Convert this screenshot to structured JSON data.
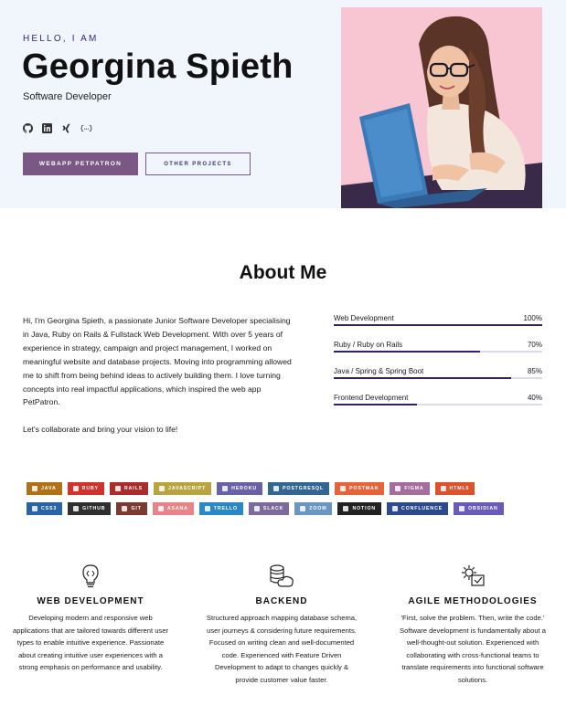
{
  "hero": {
    "greeting": "HELLO, I AM",
    "name": "Georgina Spieth",
    "role": "Software Developer",
    "socials": [
      "github-icon",
      "linkedin-icon",
      "xing-icon",
      "code-icon"
    ],
    "primary_button": "WEBAPP PETPATRON",
    "secondary_button": "OTHER PROJECTS"
  },
  "about": {
    "title": "About Me",
    "bio": [
      "Hi, I'm Georgina Spieth, a passionate Junior Software Developer specialising in Java, Ruby on Rails & Fullstack Web Development. With over 5 years of experience in strategy, campaign and project management, I worked on meaningful website and database projects. Moving into programming allowed me to shift from being behind ideas to actively building them. I love turning concepts into real impactful applications, which inspired the web app PetPatron.",
      "Let's collaborate and bring your vision to life!"
    ],
    "skills": [
      {
        "label": "Web Development",
        "percent_text": "100%",
        "value": 100
      },
      {
        "label": "Ruby / Ruby on Rails",
        "percent_text": "70%",
        "value": 70
      },
      {
        "label": "Java / Spring & Spring Boot",
        "percent_text": "85%",
        "value": 85
      },
      {
        "label": "Frontend Development",
        "percent_text": "40%",
        "value": 40
      }
    ]
  },
  "badges": [
    [
      {
        "label": "JAVA",
        "color": "#b07219"
      },
      {
        "label": "RUBY",
        "color": "#cc342d"
      },
      {
        "label": "RAILS",
        "color": "#a82d2d"
      },
      {
        "label": "JAVASCRIPT",
        "color": "#b8a542"
      },
      {
        "label": "HEROKU",
        "color": "#6762a6"
      },
      {
        "label": "POSTGRESQL",
        "color": "#336791"
      },
      {
        "label": "POSTMAN",
        "color": "#e5643c"
      },
      {
        "label": "FIGMA",
        "color": "#a56d9c"
      },
      {
        "label": "HTML5",
        "color": "#d9532f"
      }
    ],
    [
      {
        "label": "CSS3",
        "color": "#2b64a6"
      },
      {
        "label": "GITHUB",
        "color": "#2f2f2f"
      },
      {
        "label": "GIT",
        "color": "#7c3b32"
      },
      {
        "label": "ASANA",
        "color": "#e8838a"
      },
      {
        "label": "TRELLO",
        "color": "#2a89c4"
      },
      {
        "label": "SLACK",
        "color": "#7c6a9c"
      },
      {
        "label": "ZOOM",
        "color": "#6a96c4"
      },
      {
        "label": "NOTION",
        "color": "#222222"
      },
      {
        "label": "CONFLUENCE",
        "color": "#2c4a8c"
      },
      {
        "label": "OBSIDIAN",
        "color": "#6a5bb8"
      }
    ]
  ],
  "services": [
    {
      "icon": "lightbulb-code-icon",
      "title": "WEB DEVELOPMENT",
      "text": "Developing modern and responsive web applications that are tailored towards different user types to enable intuitive experience. Passionate about creating intuitive user experiences with a strong emphasis on performance and usability."
    },
    {
      "icon": "database-cloud-icon",
      "title": "BACKEND",
      "text": "Structured approach mapping database schema, user journeys & considering future requirements. Focused on writing clean and well-documented code. Experienced with Feature Driven Development to adapt to changes quickly & provide customer value faster."
    },
    {
      "icon": "gear-check-icon",
      "title": "AGILE METHODOLOGIES",
      "text": "'First, solve the problem. Then, write the code.' Software development is fundamentally about a well-thought-out solution. Experienced with collaborating with cross-functional teams to translate requirements into functional software solutions."
    }
  ],
  "colors": {
    "hero_bg": "#f0f6fc",
    "accent": "#7b5785",
    "skill_bar": "#2b2370"
  }
}
